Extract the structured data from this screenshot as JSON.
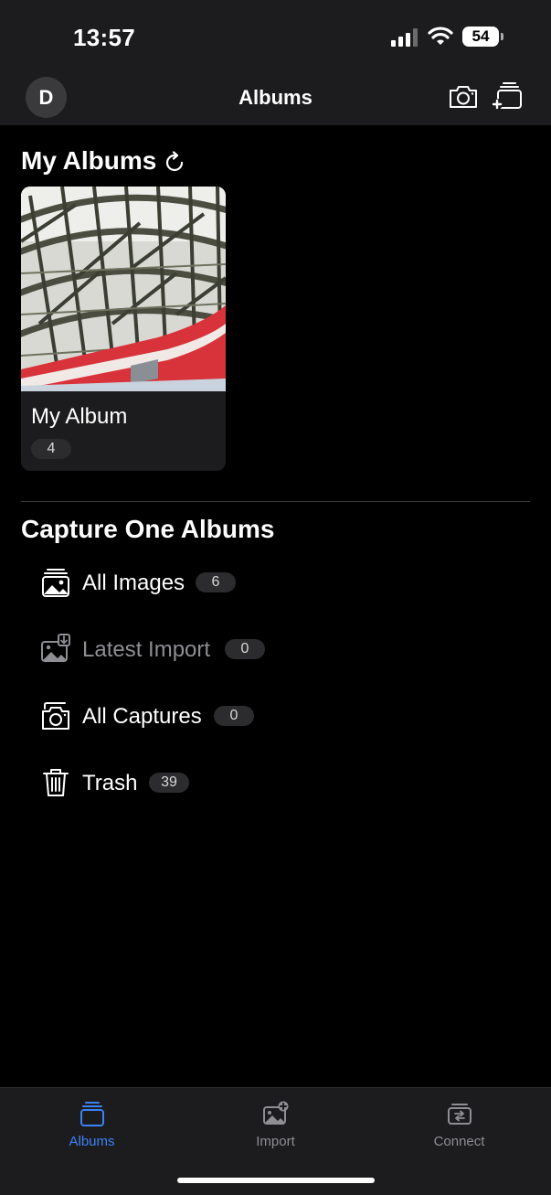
{
  "status_bar": {
    "time": "13:57",
    "battery": "54"
  },
  "nav": {
    "avatar_initial": "D",
    "title": "Albums"
  },
  "my_albums": {
    "title": "My Albums",
    "albums": [
      {
        "name": "My Album",
        "count": "4"
      }
    ]
  },
  "capture_one_albums": {
    "title": "Capture One Albums",
    "items": [
      {
        "label": "All Images",
        "count": "6",
        "icon": "images-icon",
        "enabled": true
      },
      {
        "label": "Latest Import",
        "count": "0",
        "icon": "import-icon",
        "enabled": false
      },
      {
        "label": "All Captures",
        "count": "0",
        "icon": "captures-icon",
        "enabled": true
      },
      {
        "label": "Trash",
        "count": "39",
        "icon": "trash-icon",
        "enabled": true
      }
    ]
  },
  "tabs": [
    {
      "label": "Albums",
      "icon": "albums-icon",
      "active": true
    },
    {
      "label": "Import",
      "icon": "import-photo-icon",
      "active": false
    },
    {
      "label": "Connect",
      "icon": "connect-icon",
      "active": false
    }
  ],
  "colors": {
    "accent": "#3b82f6",
    "background": "#000000",
    "bar": "#1c1c1e",
    "inactive": "#8e8e93"
  }
}
